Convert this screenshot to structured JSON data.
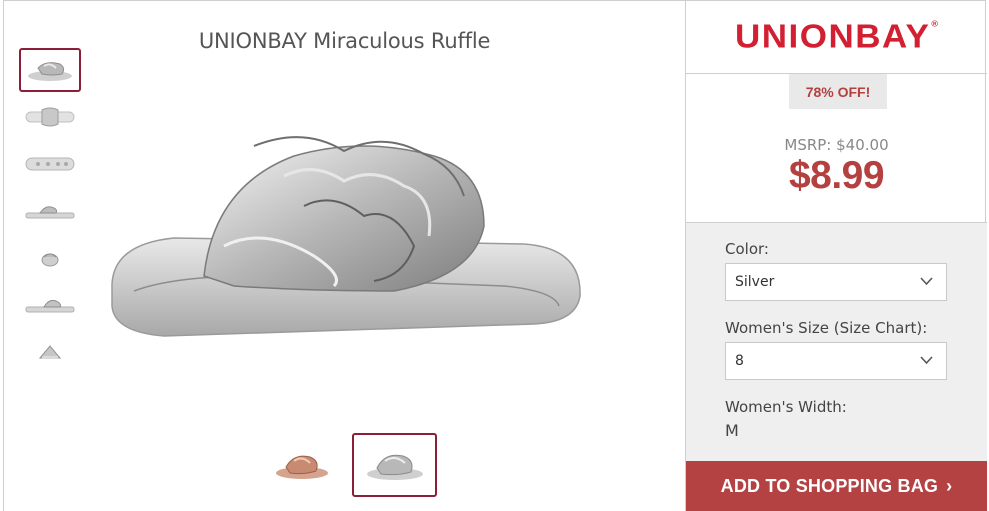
{
  "product": {
    "title": "UNIONBAY Miraculous Ruffle",
    "brand": "UNIONBAY",
    "brand_mark": "®",
    "discount_badge": "78% OFF!",
    "msrp": "MSRP: $40.00",
    "price": "$8.99"
  },
  "thumbnails": [
    {
      "view": "angle",
      "selected": true
    },
    {
      "view": "top",
      "selected": false
    },
    {
      "view": "bottom",
      "selected": false
    },
    {
      "view": "side",
      "selected": false
    },
    {
      "view": "front",
      "selected": false
    },
    {
      "view": "side-2",
      "selected": false
    },
    {
      "view": "back",
      "selected": false
    }
  ],
  "color_swatches": [
    {
      "color": "Rose Gold",
      "selected": false
    },
    {
      "color": "Silver",
      "selected": true
    }
  ],
  "options": {
    "color_label": "Color:",
    "color_value": "Silver",
    "size_label": "Women's Size (Size Chart):",
    "size_value": "8",
    "width_label": "Women's Width:",
    "width_value": "M"
  },
  "add_button": {
    "label": "ADD TO SHOPPING BAG",
    "arrow": "›"
  },
  "colors": {
    "brand_red": "#d21f32",
    "price_red": "#b44040",
    "button_red": "#b54243",
    "selected_border": "#8a1f37"
  }
}
